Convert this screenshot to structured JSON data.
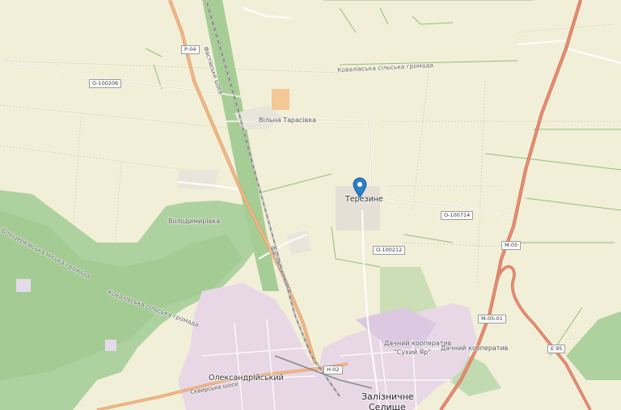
{
  "places": {
    "tereshyne": "Терезине",
    "vilna_tarasivka": "Вільна Тарасівка",
    "volodymyrivka": "Володимирівка",
    "oleksandriiskyi": "Олександрійський",
    "zaliznychne_line1": "Залізничне",
    "zaliznychne_line2": "Селище",
    "dachnyi_1_line1": "Дачний кооператив",
    "dachnyi_1_line2": "\"Сухий Яр\"",
    "dachnyi_2": "Дачний кооператив"
  },
  "admin": {
    "kovalivska": "Ковалівська сільська громада",
    "forest_label_1": "Білоцерківська міська громада",
    "forest_label_2": "Ковалівська сільська громада"
  },
  "road_shields": {
    "p04": "Р-04",
    "o100206": "О-100206",
    "o100714": "О-100714",
    "o100212": "О-100212",
    "m05": "М-05",
    "m0501": "М-05-01",
    "e95": "Е 95",
    "n02": "Н-02"
  },
  "road_names": {
    "fastivske_1": "Фастівське шосе",
    "fastivske_2": "Фастівське шосе",
    "skvyrske": "Сквирське шосе"
  },
  "colors": {
    "background": "#f2efd9",
    "forest": "#aed1a0",
    "forest_dark": "#9cc68c",
    "urban": "#e8d8e6",
    "urban_dark": "#dcc8e0",
    "primary_road": "#f3b889",
    "motorway": "#e88f73",
    "railway": "#777777",
    "marker": "#2a7fc7"
  },
  "marker_icon": "map-pin-icon"
}
